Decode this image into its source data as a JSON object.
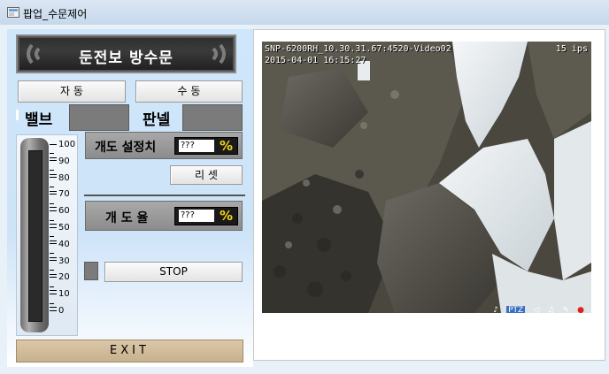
{
  "window": {
    "title": "팝업_수문제어"
  },
  "banner": {
    "title": "둔전보 방수문"
  },
  "mode": {
    "auto_label": "자 동",
    "manual_label": "수 동"
  },
  "status": {
    "valve_label": "밸브",
    "panel_label": "판넬"
  },
  "gauge": {
    "ticks": [
      "100",
      "90",
      "80",
      "70",
      "60",
      "50",
      "40",
      "30",
      "20",
      "10",
      "0"
    ]
  },
  "setpoint": {
    "label": "개도 설정치",
    "value": "???",
    "unit": "%"
  },
  "reset": {
    "label": "리 셋"
  },
  "opening": {
    "label": "개 도 율",
    "value": "???",
    "unit": "%"
  },
  "stop": {
    "label": "STOP"
  },
  "exit": {
    "label": "EXIT"
  },
  "video": {
    "overlay_top_left": "SNP-6200RH_10.30.31.67:4520-Video02",
    "overlay_date": "2015-04-01 16:15:27",
    "fps": "15 ips",
    "status_icons": [
      "mic-icon",
      "ptz-icon",
      "speaker-icon",
      "bell-icon",
      "wrench-icon",
      "record-icon"
    ],
    "ptz_label": "PTZ"
  }
}
